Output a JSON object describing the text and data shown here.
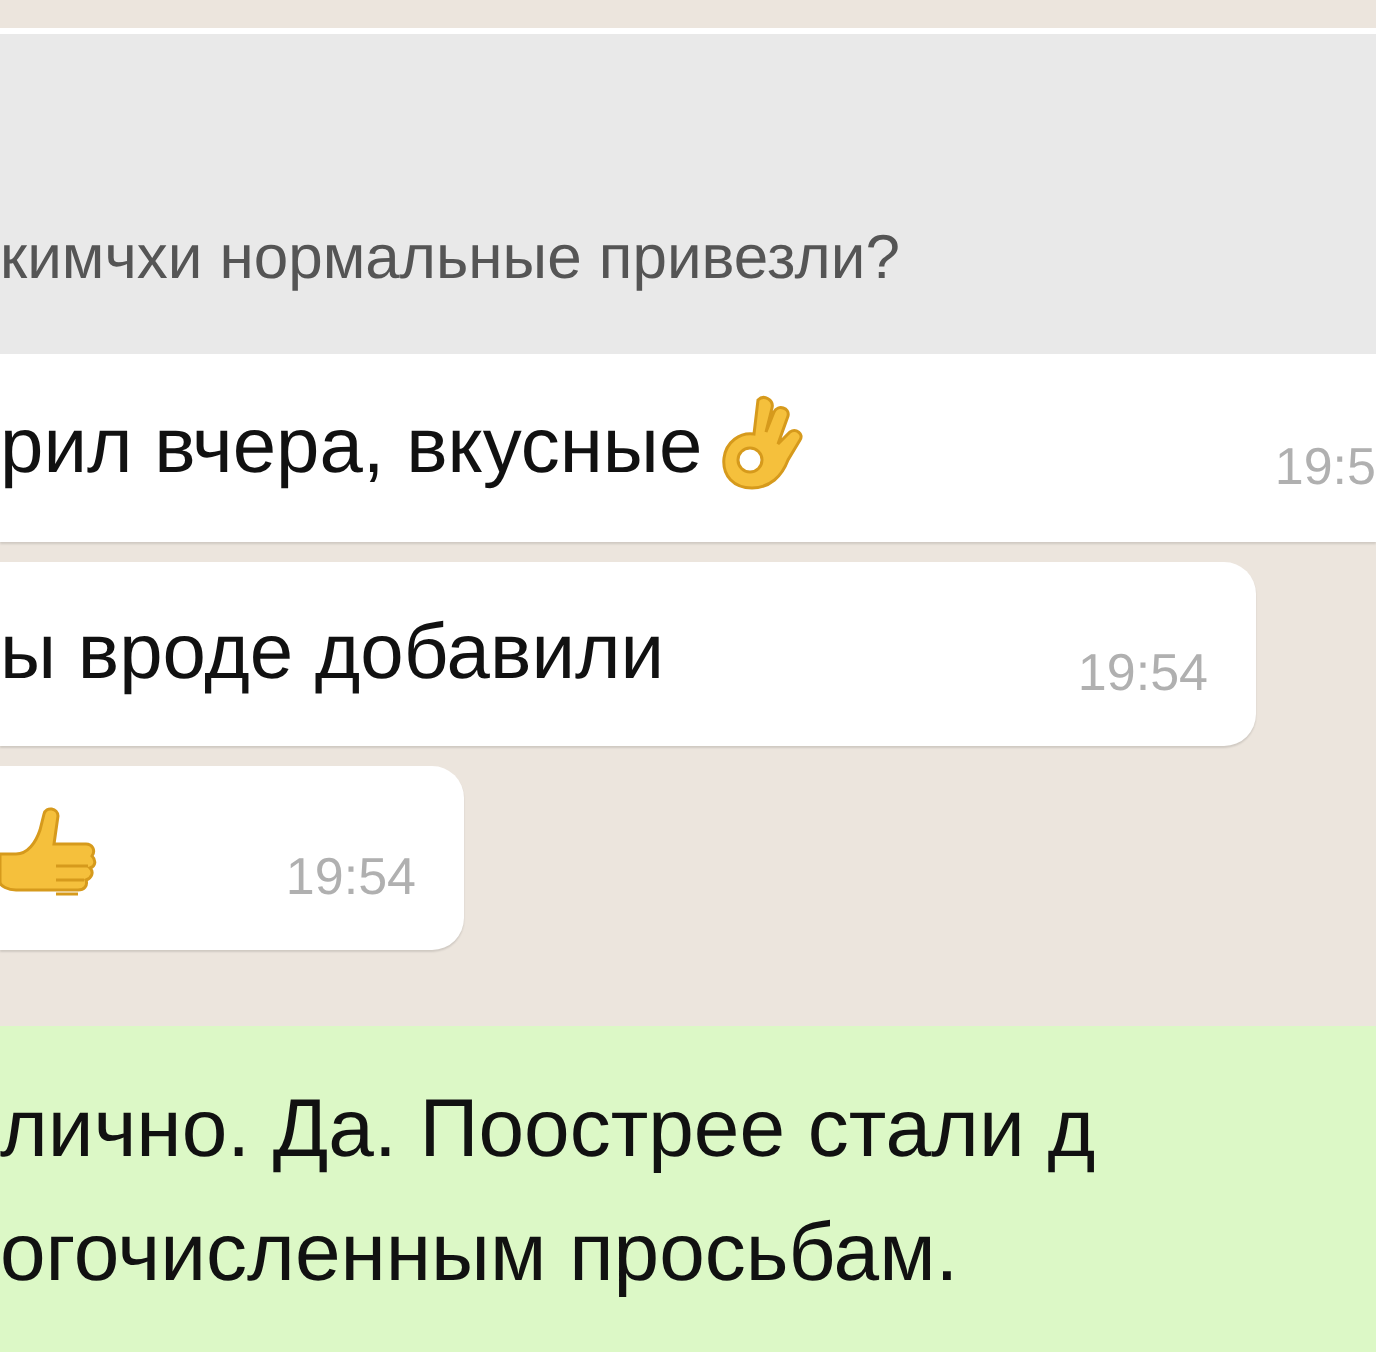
{
  "messages": [
    {
      "kind": "reply",
      "outgoing": false,
      "quote": "кимчхи нормальные привезли?",
      "text": "рил вчера, вкусные",
      "ok_sign": true,
      "time": "19:5"
    },
    {
      "kind": "text",
      "outgoing": false,
      "text": "ы вроде добавили",
      "time": "19:54"
    },
    {
      "kind": "thumbs-up",
      "outgoing": false,
      "time": "19:54"
    },
    {
      "kind": "lines",
      "outgoing": true,
      "lines": [
        "лично. Да. Поострее стали д",
        "огочисленным просьбам."
      ]
    }
  ]
}
